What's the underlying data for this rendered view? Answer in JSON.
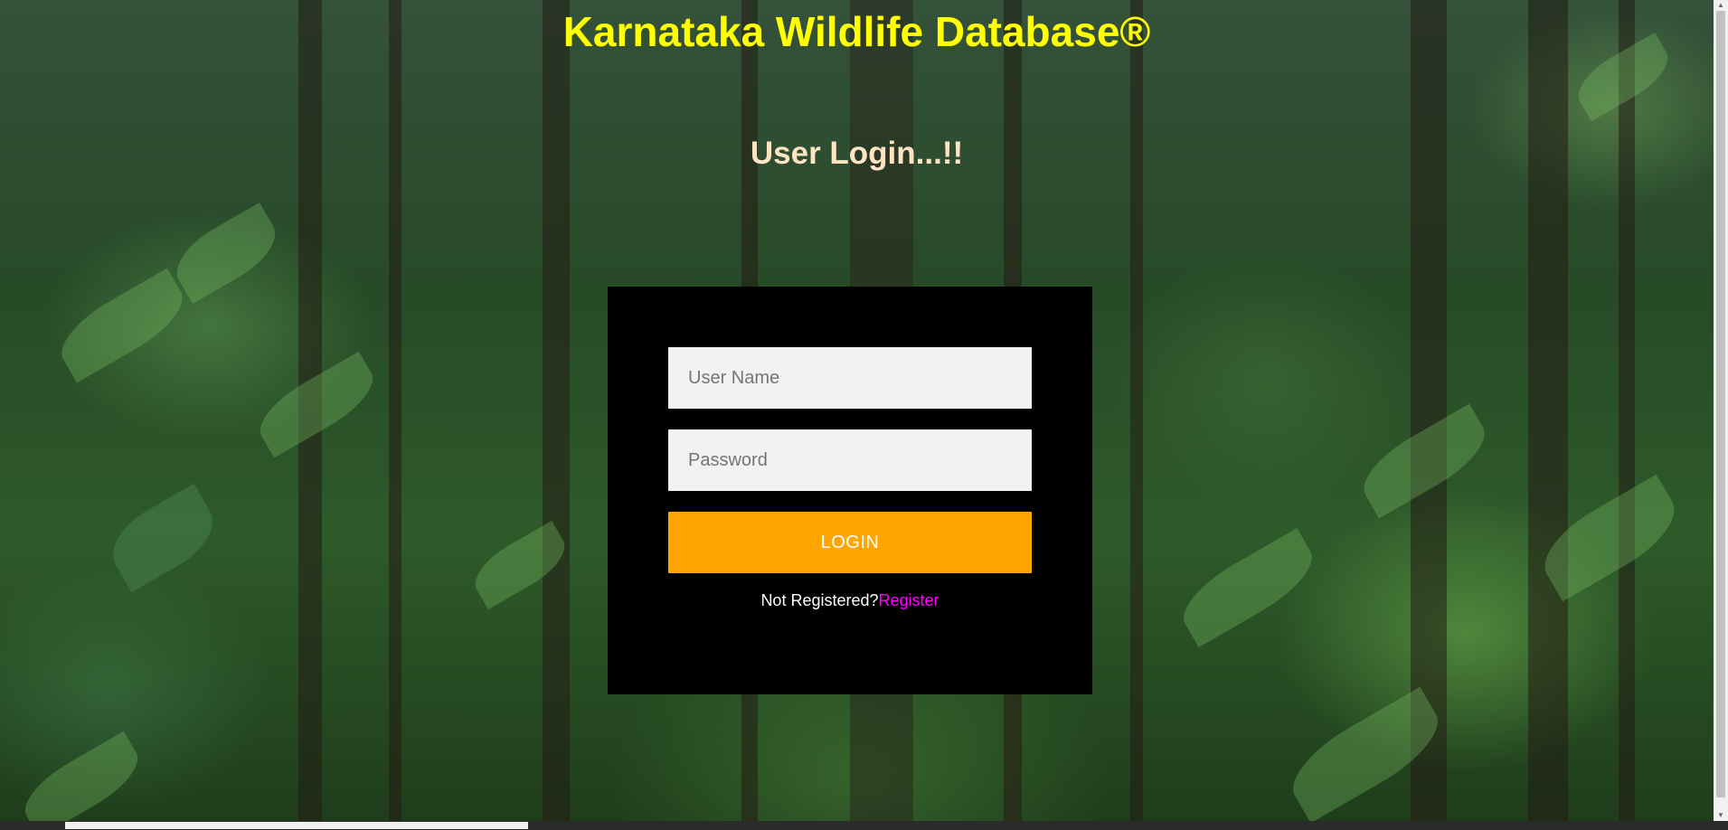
{
  "header": {
    "title": "Karnataka Wildlife Database®",
    "subtitle": "User Login...!!"
  },
  "login_form": {
    "username_placeholder": "User Name",
    "password_placeholder": "Password",
    "login_label": "LOGIN",
    "register_prompt": "Not Registered?",
    "register_link": "Register"
  },
  "colors": {
    "title": "#ffff00",
    "subtitle": "#ffe4c4",
    "panel": "#000000",
    "button": "#ffa500",
    "link": "#ff00ff"
  }
}
